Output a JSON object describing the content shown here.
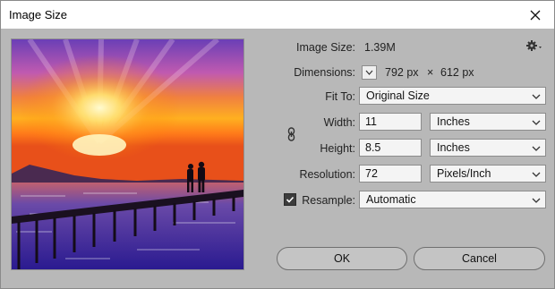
{
  "window": {
    "title": "Image Size"
  },
  "info": {
    "image_size_label": "Image Size:",
    "image_size_value": "1.39M",
    "dimensions_label": "Dimensions:",
    "dim_width": "792 px",
    "dim_separator": "×",
    "dim_height": "612 px"
  },
  "fit_to": {
    "label": "Fit To:",
    "value": "Original Size"
  },
  "width": {
    "label": "Width:",
    "value": "11",
    "unit": "Inches"
  },
  "height": {
    "label": "Height:",
    "value": "8.5",
    "unit": "Inches"
  },
  "resolution": {
    "label": "Resolution:",
    "value": "72",
    "unit": "Pixels/Inch"
  },
  "resample": {
    "label": "Resample:",
    "checked": true,
    "value": "Automatic"
  },
  "buttons": {
    "ok": "OK",
    "cancel": "Cancel"
  },
  "colors": {
    "dialog_bg": "#b8b8b8",
    "field_bg": "#f4f4f4",
    "sky_top": "#6b3fb5",
    "sun": "#fff2a0",
    "sea": "#3a2aa0"
  }
}
